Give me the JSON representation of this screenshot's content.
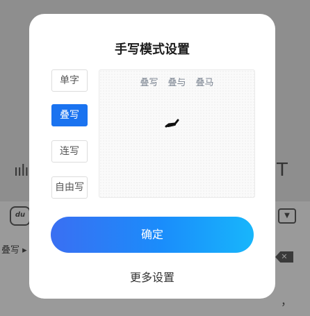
{
  "background": {
    "mode_indicator": "叠写 ▸",
    "wave_glyph": "ıılıı",
    "t_glyph": "T",
    "du_label": "du",
    "chevron_icon": "chevron-down-icon",
    "comma": "，"
  },
  "dialog": {
    "title": "手写模式设置",
    "modes": [
      {
        "label": "单字",
        "active": false
      },
      {
        "label": "叠写",
        "active": true
      },
      {
        "label": "连写",
        "active": false
      },
      {
        "label": "自由写",
        "active": false
      }
    ],
    "preview": {
      "candidates": [
        "叠写",
        "叠与",
        "叠马"
      ]
    },
    "confirm_label": "确定",
    "more_label": "更多设置"
  },
  "colors": {
    "accent": "#1a73f0",
    "confirm_start": "#3a6ff2",
    "confirm_end": "#18b6fb"
  }
}
